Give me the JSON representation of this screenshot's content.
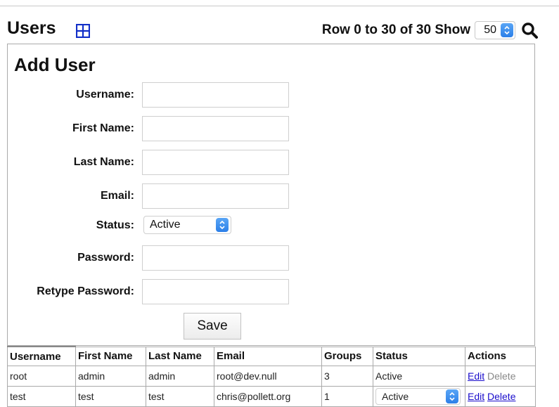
{
  "header": {
    "title": "Users",
    "pager_text": "Row 0 to 30 of 30 Show",
    "show_value": "50"
  },
  "form": {
    "title": "Add User",
    "fields": {
      "username": {
        "label": "Username:",
        "value": ""
      },
      "first_name": {
        "label": "First Name:",
        "value": ""
      },
      "last_name": {
        "label": "Last Name:",
        "value": ""
      },
      "email": {
        "label": "Email:",
        "value": ""
      },
      "status": {
        "label": "Status:",
        "value": "Active"
      },
      "password": {
        "label": "Password:",
        "value": ""
      },
      "retype_password": {
        "label": "Retype Password:",
        "value": ""
      }
    },
    "save_label": "Save"
  },
  "table": {
    "columns": [
      "Username",
      "First Name",
      "Last Name",
      "Email",
      "Groups",
      "Status",
      "Actions"
    ],
    "rows": [
      {
        "username": "root",
        "first_name": "admin",
        "last_name": "admin",
        "email": "root@dev.null",
        "groups": "3",
        "status": "Active",
        "edit": "Edit",
        "delete": "Delete"
      },
      {
        "username": "test",
        "first_name": "test",
        "last_name": "test",
        "email": "chris@pollett.org",
        "groups": "1",
        "status": "Active",
        "edit": "Edit",
        "delete": "Delete"
      }
    ]
  },
  "icons": {
    "add": "add-grid-icon",
    "search": "search-icon"
  },
  "colors": {
    "accent": "#2c7fe8",
    "link": "#1a0dcc",
    "add_icon": "#1330c8"
  }
}
